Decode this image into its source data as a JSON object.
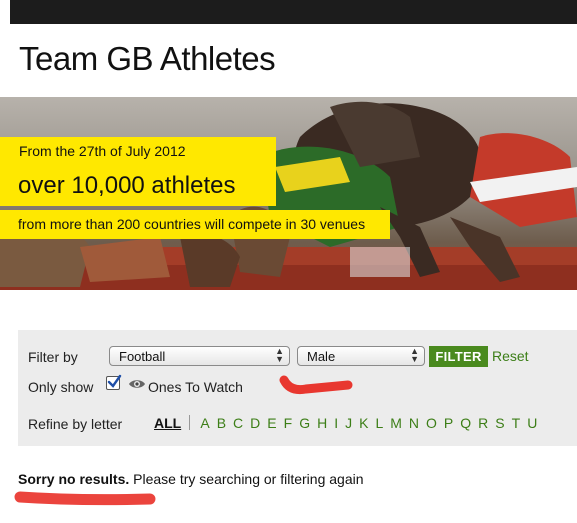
{
  "page": {
    "title": "Team GB Athletes"
  },
  "hero": {
    "date_line": "From the 27th of July 2012",
    "big_line": "over 10,000 athletes",
    "sub_line": "from more than 200 countries will compete in 30 venues"
  },
  "filter": {
    "label": "Filter by",
    "sport_select": {
      "value": "Football"
    },
    "gender_select": {
      "value": "Male"
    },
    "filter_button": "FILTER",
    "reset_link": "Reset",
    "only_show_label": "Only show",
    "ones_to_watch": {
      "checked": true,
      "label": "Ones To Watch"
    },
    "refine_label": "Refine by letter",
    "all_link": "ALL",
    "letters": [
      "A",
      "B",
      "C",
      "D",
      "E",
      "F",
      "G",
      "H",
      "I",
      "J",
      "K",
      "L",
      "M",
      "N",
      "O",
      "P",
      "Q",
      "R",
      "S",
      "T",
      "U"
    ]
  },
  "results": {
    "bold": "Sorry no results.",
    "rest": "Please try searching or filtering again"
  },
  "colors": {
    "accent_green": "#4a8a1e",
    "link_green": "#3c7e17",
    "banner_yellow": "#ffe800",
    "annotation_red": "#e8231b"
  },
  "icons": {
    "eye": "eye-icon",
    "check": "checkmark-icon",
    "select_arrows": "updown-arrows-icon"
  }
}
